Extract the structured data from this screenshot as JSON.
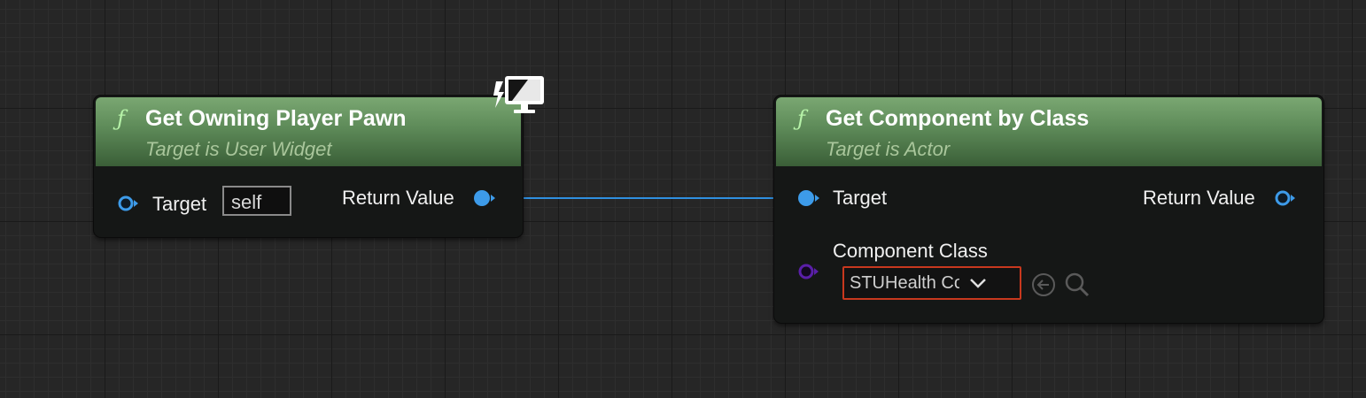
{
  "nodes": {
    "owning_pawn": {
      "function_glyph": "ƒ",
      "title": "Get Owning Player Pawn",
      "subtitle": "Target is User Widget",
      "target_label": "Target",
      "target_default": "self",
      "return_label": "Return Value",
      "badge_icon": "screen-with-lightning-icon"
    },
    "get_component": {
      "function_glyph": "ƒ",
      "title": "Get Component by Class",
      "subtitle": "Target is Actor",
      "target_label": "Target",
      "return_label": "Return Value",
      "component_class_label": "Component Class",
      "component_class_value": "STUHealth Comp",
      "buttons": [
        "use-selected-asset-icon",
        "browse-search-icon"
      ]
    }
  },
  "colors": {
    "header_green": "#5d8a58",
    "object_pin_blue": "#3d9be9",
    "class_pin_purple": "#5a1fa8",
    "wire_blue": "#2f8fe0",
    "highlight_red": "#c8381e"
  }
}
